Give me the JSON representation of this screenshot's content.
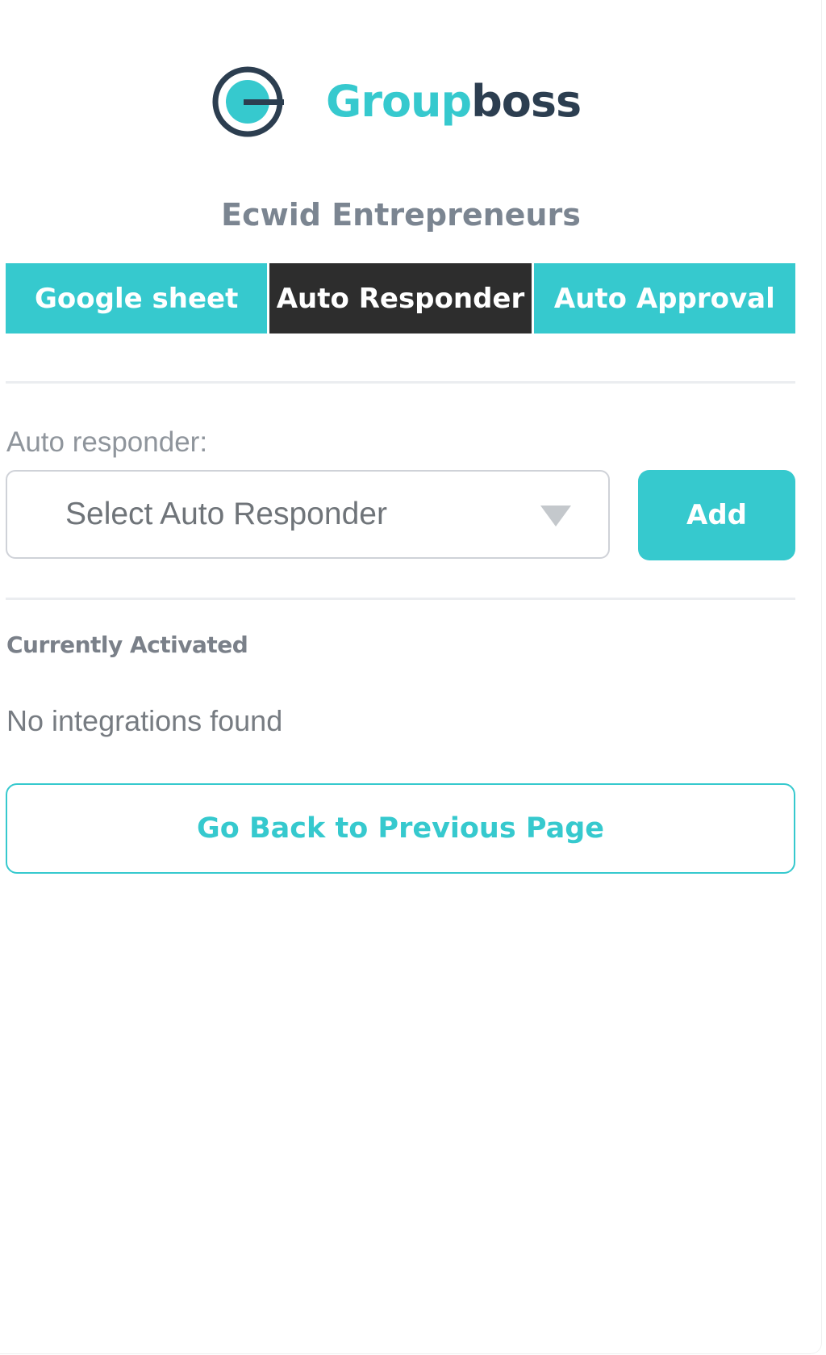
{
  "brand": {
    "name_part1": "Group",
    "name_part2": "boss",
    "logo_icon": "groupboss-logo-icon",
    "primary_color": "#36c9ce",
    "dark_color": "#2c3e50"
  },
  "group": {
    "title": "Ecwid Entrepreneurs"
  },
  "tabs": [
    {
      "label": "Google sheet",
      "active": false
    },
    {
      "label": "Auto Responder",
      "active": true
    },
    {
      "label": "Auto Approval",
      "active": false
    }
  ],
  "autoresponder": {
    "label": "Auto responder:",
    "select_value": "Select Auto Responder",
    "caret_icon": "caret-down-icon",
    "add_label": "Add"
  },
  "activated": {
    "title": "Currently Activated",
    "empty_text": "No integrations found"
  },
  "footer": {
    "back_label": "Go Back to Previous Page"
  },
  "colors": {
    "active_tab": "#2d2d2d",
    "muted_text": "#8f959c"
  }
}
